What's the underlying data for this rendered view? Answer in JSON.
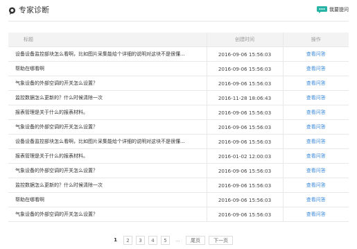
{
  "header": {
    "title": "专家诊断",
    "ask_label": "我要提问",
    "icons": {
      "title": "question-bubble-icon",
      "ask": "ask-question-icon"
    },
    "accent": "#27b4a6"
  },
  "table": {
    "columns": [
      "标题",
      "创建时间",
      "操作"
    ],
    "rows": [
      {
        "title": "设备设备监控部块怎么看啊，比如图片采集能给个详细的说明对这块不是很懂...",
        "time": "2016-09-06 15:56:03",
        "action": "查看问答"
      },
      {
        "title": "帮助在哪看啊",
        "time": "2016-09-06 15:56:03",
        "action": "查看问答"
      },
      {
        "title": "气象设备的外部空调的开关怎么设置？",
        "time": "2016-09-06 15:56:03",
        "action": "查看问答"
      },
      {
        "title": "监控数据怎么更新的？什么时候清除一次",
        "time": "2016-11-28 18:06:43",
        "action": "查看问答"
      },
      {
        "title": "报表管理是关于什么的报表材料。",
        "time": "2016-09-06 15:56:03",
        "action": "查看问答"
      },
      {
        "title": "气象设备的外部空调的开关怎么设置？",
        "time": "2016-09-06 15:56:03",
        "action": "查看问答"
      },
      {
        "title": "设备设备监控部块怎么看啊，比如图片采集能给个详细的说明对这块不是很懂...",
        "time": "2016-09-06 15:56:03",
        "action": "查看问答"
      },
      {
        "title": "报表管理是关于什么的报表材料。",
        "time": "2016-01-02 12:00:03",
        "action": "查看问答"
      },
      {
        "title": "气象设备的外部空调的开关怎么设置？",
        "time": "2016-09-06 15:56:03",
        "action": "查看问答"
      },
      {
        "title": "监控数据怎么更新的？什么时候清除一次",
        "time": "2016-09-06 15:56:03",
        "action": "查看问答"
      },
      {
        "title": "帮助在哪看啊",
        "time": "2016-09-06 15:56:03",
        "action": "查看问答"
      },
      {
        "title": "气象设备的外部空调的开关怎么设置？",
        "time": "2016-09-06 15:56:03",
        "action": "查看问答"
      }
    ],
    "link_color": "#3d8bd9"
  },
  "pagination": {
    "current": "1",
    "pages": [
      "2",
      "3",
      "4",
      "5"
    ],
    "ellipsis": "...",
    "last_label": "尾页",
    "next_label": "下一页"
  }
}
